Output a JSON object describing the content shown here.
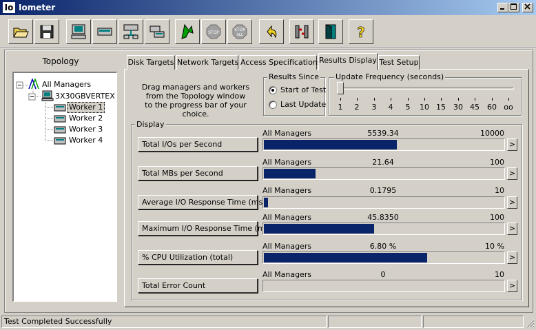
{
  "window": {
    "app_icon_text": "Io",
    "title": "Iometer"
  },
  "topology": {
    "title": "Topology",
    "root": "All Managers",
    "manager": "3X30GBVERTEX",
    "workers": [
      "Worker 1",
      "Worker 2",
      "Worker 3",
      "Worker 4"
    ],
    "selected_worker_index": 0
  },
  "tabs": [
    {
      "label": "Disk Targets"
    },
    {
      "label": "Network Targets"
    },
    {
      "label": "Access Specifications"
    },
    {
      "label": "Results Display"
    },
    {
      "label": "Test Setup"
    }
  ],
  "active_tab": "Results Display",
  "instructions": {
    "line1": "Drag managers and workers",
    "line2": "from the Topology window",
    "line3": "to the progress bar of your choice."
  },
  "results_since": {
    "title": "Results Since",
    "options": [
      "Start of Test",
      "Last Update"
    ],
    "selected": "Start of Test"
  },
  "update_frequency": {
    "title": "Update Frequency (seconds)",
    "ticks": [
      "1",
      "2",
      "3",
      "4",
      "5",
      "10",
      "15",
      "30",
      "45",
      "60",
      "oo"
    ],
    "selected": "1"
  },
  "display": {
    "title": "Display",
    "metrics": [
      {
        "label": "Total I/Os per Second",
        "scope": "All Managers",
        "value": "5539.34",
        "max": "10000",
        "fraction": 0.5539
      },
      {
        "label": "Total MBs per Second",
        "scope": "All Managers",
        "value": "21.64",
        "max": "100",
        "fraction": 0.2164
      },
      {
        "label": "Average I/O Response Time (ms)",
        "scope": "All Managers",
        "value": "0.1795",
        "max": "10",
        "fraction": 0.018
      },
      {
        "label": "Maximum I/O Response Time (ms)",
        "scope": "All Managers",
        "value": "45.8350",
        "max": "100",
        "fraction": 0.4584
      },
      {
        "label": "% CPU Utilization (total)",
        "scope": "All Managers",
        "value": "6.80 %",
        "max": "10 %",
        "fraction": 0.68
      },
      {
        "label": "Total Error Count",
        "scope": "All Managers",
        "value": "0",
        "max": "10",
        "fraction": 0
      }
    ],
    "arrow_glyph": ">"
  },
  "status_bar": {
    "message": "Test Completed Successfully"
  },
  "colors": {
    "progress_fill": "#0a246a",
    "face": "#d4d0c8"
  }
}
